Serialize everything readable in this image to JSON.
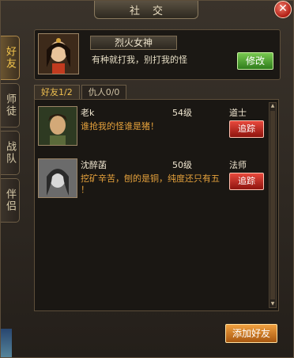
{
  "window": {
    "title": "社交",
    "close_label": "✕"
  },
  "side_tabs": [
    "好友",
    "师徒",
    "战队",
    "伴侣"
  ],
  "profile": {
    "name": "烈火女神",
    "signature": "有种就打我，别打我的怪",
    "edit_label": "修改"
  },
  "tabs": [
    "好友1/2",
    "仇人0/0"
  ],
  "friends": [
    {
      "name": "老k",
      "level": "54级",
      "class": "道士",
      "signature_line1": "谁抢我的怪谁是猪！",
      "signature_line2": "",
      "track_label": "追踪"
    },
    {
      "name": "沈醉菡",
      "level": "50级",
      "class": "法师",
      "signature_line1": "挖矿辛苦，刨的是铜，纯度还只有五",
      "signature_line2": "！",
      "track_label": "追踪"
    }
  ],
  "add_friend_label": "添加好友"
}
